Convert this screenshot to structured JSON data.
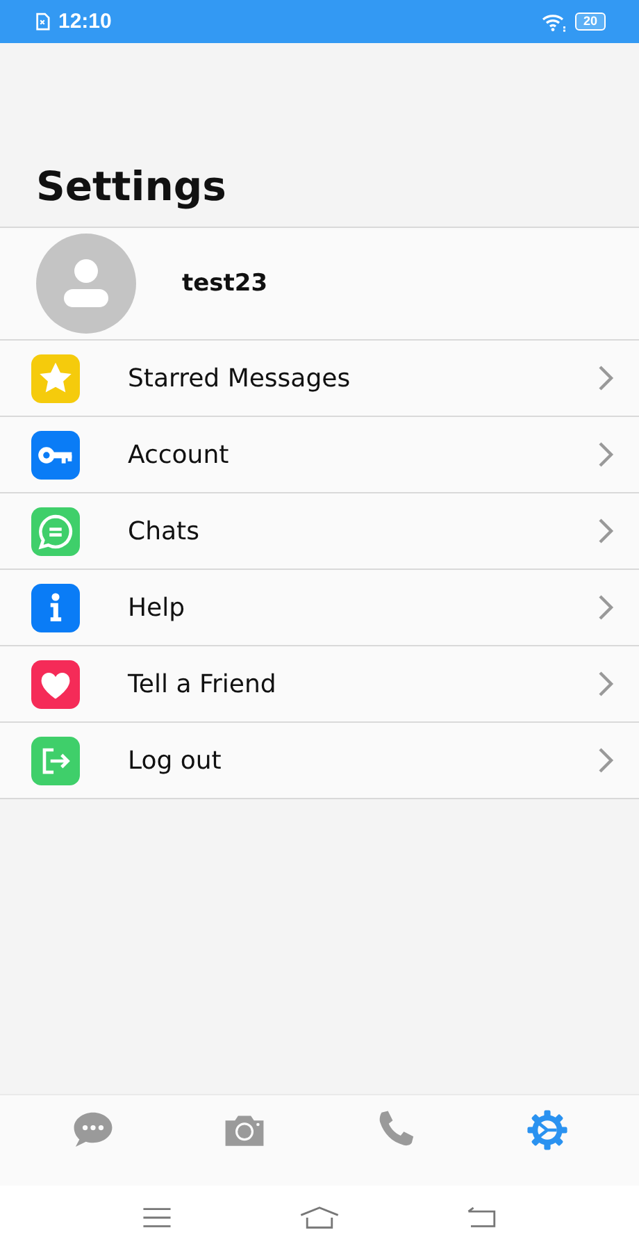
{
  "status_bar": {
    "time": "12:10",
    "battery": "20"
  },
  "title": "Settings",
  "profile": {
    "name": "test23"
  },
  "items": [
    {
      "kind": "star",
      "label": "Starred Messages",
      "color": "#f5cb0c"
    },
    {
      "kind": "key",
      "label": "Account",
      "color": "#0a7cf6"
    },
    {
      "kind": "chat",
      "label": "Chats",
      "color": "#3fcf6a"
    },
    {
      "kind": "info",
      "label": "Help",
      "color": "#0a7cf6"
    },
    {
      "kind": "heart",
      "label": "Tell a Friend",
      "color": "#f52b58"
    },
    {
      "kind": "logout",
      "label": "Log out",
      "color": "#3fcf6a"
    }
  ],
  "tabs": [
    {
      "kind": "chats",
      "selected": false
    },
    {
      "kind": "camera",
      "selected": false
    },
    {
      "kind": "calls",
      "selected": false
    },
    {
      "kind": "settings",
      "selected": true
    }
  ]
}
